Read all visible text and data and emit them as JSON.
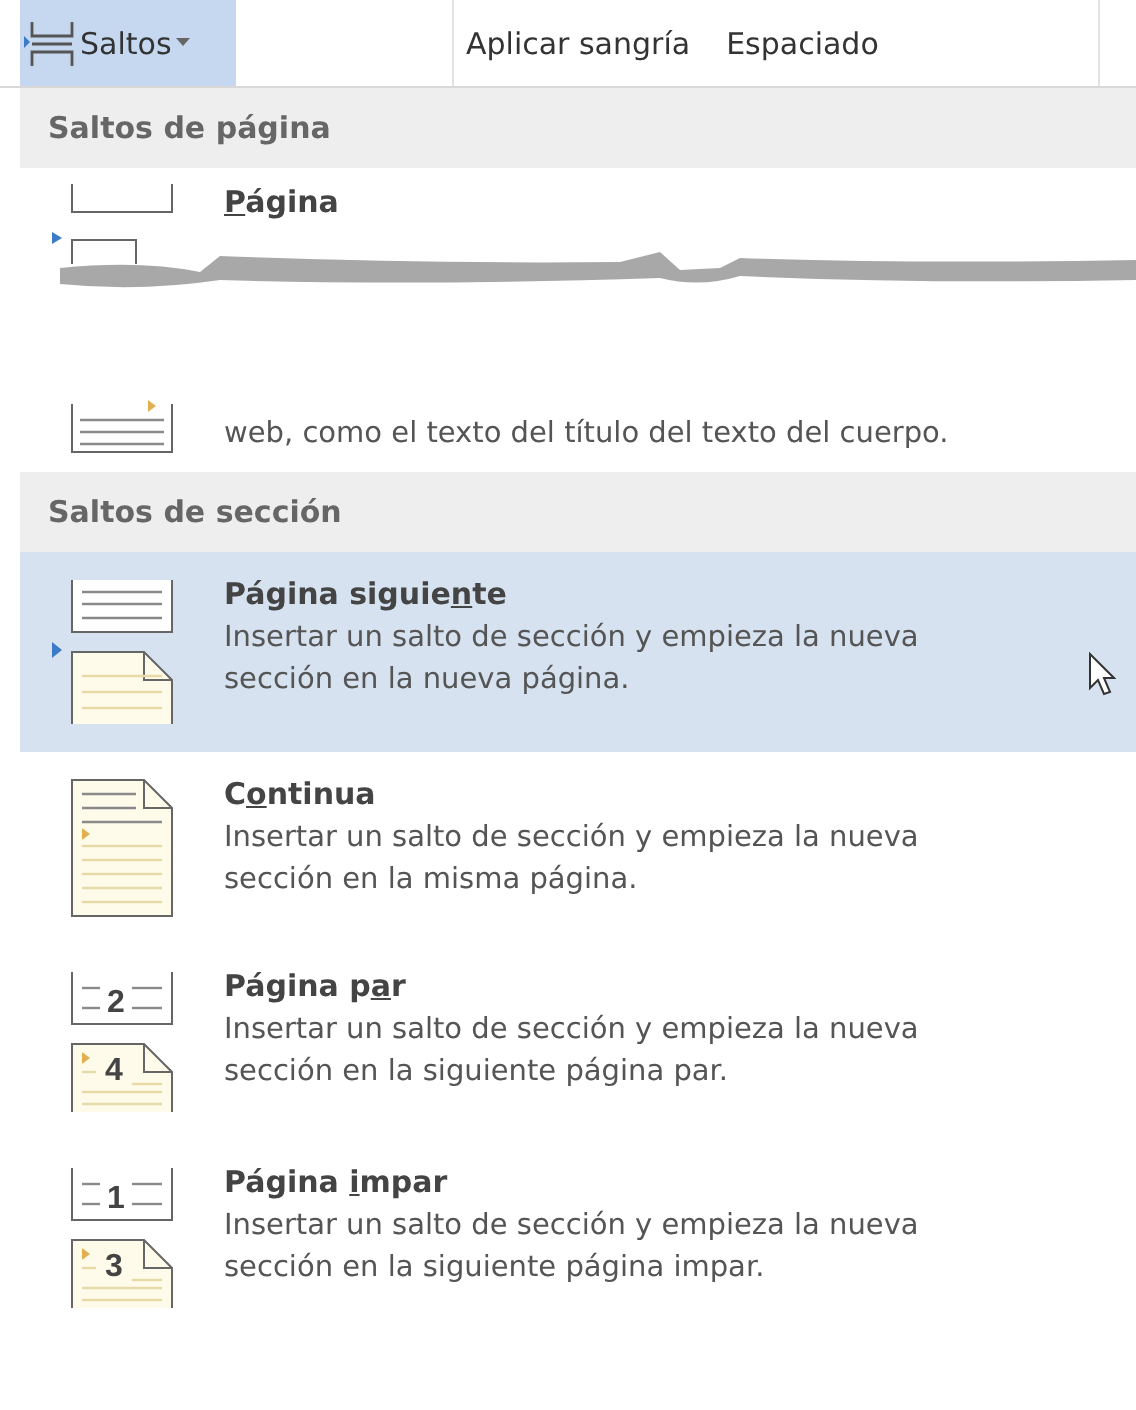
{
  "toolbar": {
    "breaks_button": {
      "label": "Saltos",
      "selected": true
    },
    "items": [
      "Aplicar sangría",
      "Espaciado"
    ]
  },
  "page_breaks": {
    "header": "Saltos de página",
    "items": [
      {
        "kind": "page",
        "title": {
          "key": "P",
          "after": "ágina"
        }
      },
      {
        "kind": "wrap",
        "description": "web, como el texto del título del texto del cuerpo."
      }
    ]
  },
  "section_breaks": {
    "header": "Saltos de sección",
    "items": [
      {
        "kind": "next",
        "selected": true,
        "hovered": true,
        "title": {
          "before": "Página siguie",
          "key": "n",
          "after": "te"
        },
        "description": "Insertar un salto de sección y empieza la nueva sección en la nueva página."
      },
      {
        "kind": "continuous",
        "selected": false,
        "hovered": false,
        "title": {
          "before": "C",
          "key": "o",
          "after": "ntinua"
        },
        "description": "Insertar un salto de sección y empieza la nueva sección en la misma página."
      },
      {
        "kind": "even",
        "selected": false,
        "hovered": false,
        "icon_numbers": [
          "2",
          "4"
        ],
        "title": {
          "before": "Página p",
          "key": "a",
          "after": "r"
        },
        "description": "Insertar un salto de sección y empieza la nueva sección en la siguiente página par."
      },
      {
        "kind": "odd",
        "selected": false,
        "hovered": false,
        "icon_numbers": [
          "1",
          "3"
        ],
        "title": {
          "before": "Página ",
          "key": "i",
          "after": "mpar"
        },
        "description": "Insertar un salto de sección y empieza la nueva sección en la siguiente página impar."
      }
    ]
  }
}
